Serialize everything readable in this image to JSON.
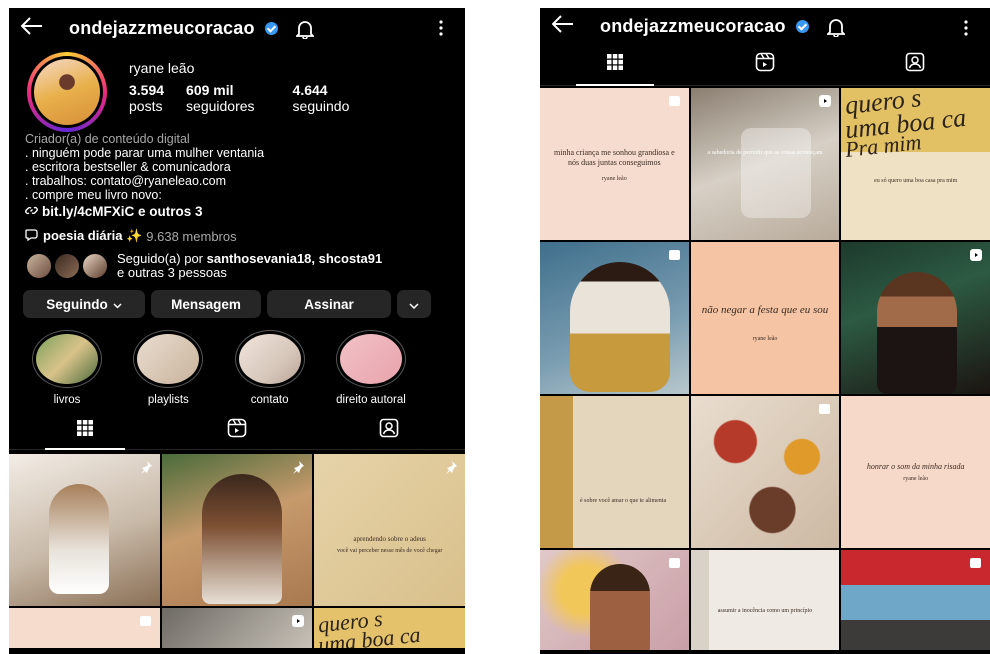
{
  "left": {
    "handle": "ondejazzmeucoracao",
    "display_name": "ryane leão",
    "stats": [
      {
        "num": "3.594",
        "label": "posts"
      },
      {
        "num": "609 mil",
        "label": "seguidores"
      },
      {
        "num": "4.644",
        "label": "seguindo"
      }
    ],
    "bio": {
      "category": "Criador(a) de conteúdo digital",
      "lines": [
        ". ninguém pode parar uma mulher ventania",
        ". escritora bestseller & comunicadora",
        ". trabalhos: contato@ryaneleao.com",
        ". compre meu livro novo:"
      ],
      "link": "bit.ly/4cMFXiC e outros 3"
    },
    "channel": {
      "name": "poesia diária ✨",
      "members": "9.638 membros"
    },
    "followed_by": {
      "prefix": "Seguido(a) por ",
      "names": "santhosevania18, shcosta91",
      "suffix": "e outras 3 pessoas"
    },
    "buttons": {
      "following": "Seguindo",
      "message": "Mensagem",
      "subscribe": "Assinar"
    },
    "highlights": [
      {
        "label": "livros"
      },
      {
        "label": "playlists"
      },
      {
        "label": "contato"
      },
      {
        "label": "direito autoral"
      }
    ],
    "grid": {
      "c3_text": "aprendendo sobre o adeus",
      "c3_sub": "você vai perceber nesse mês de você chegar"
    }
  },
  "right": {
    "handle": "ondejazzmeucoracao",
    "grid": {
      "p1_text": "minha criança me sonhou grandiosa e nós duas juntas conseguimos",
      "p1_sig": "ryane leão",
      "p2_text": "a sabedoria de permitir que as coisas aconteçam",
      "p3_big1": "quero s",
      "p3_big2": "uma boa ca",
      "p3_big3": "Pra mim",
      "p3_small": "eu só quero uma boa casa pra mim",
      "p5_text": "não negar a festa que eu sou",
      "p5_sig": "ryane leão",
      "p7_text": "é sobre você amar o que te alimenta",
      "p9_text": "honrar o som da minha risada",
      "p9_sig": "ryane leão",
      "p11_text": "assumir a inocência como um princípio"
    }
  },
  "colors": {
    "bg": "#000000",
    "button": "#262626",
    "verified": "#3897f0",
    "muted": "#a8a8a8"
  }
}
